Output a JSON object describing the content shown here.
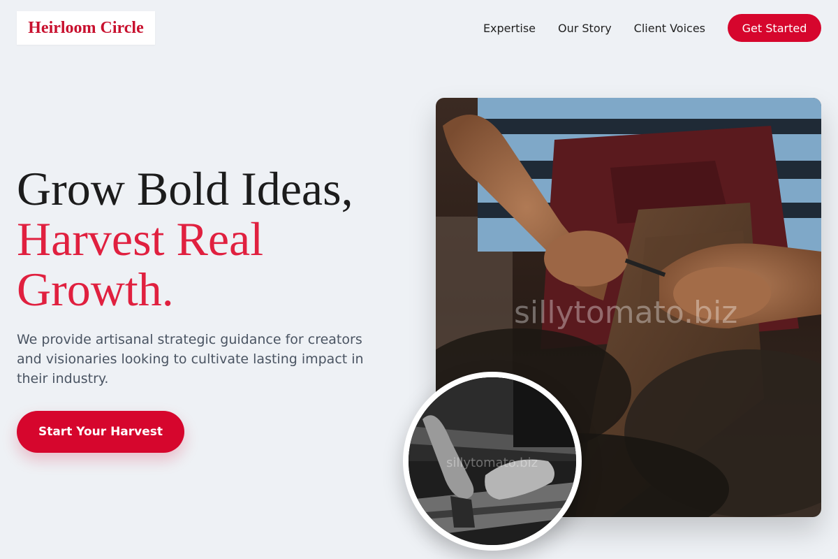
{
  "brand": {
    "name": "Heirloom Circle"
  },
  "nav": {
    "links": [
      "Expertise",
      "Our Story",
      "Client Voices"
    ],
    "cta_label": "Get Started"
  },
  "hero": {
    "headline_line1": "Grow Bold Ideas,",
    "headline_line2": "Harvest Real Growth.",
    "subtext": "We provide artisanal strategic guidance for creators and visionaries looking to cultivate lasting impact in their industry.",
    "cta_label": "Start Your Harvest"
  },
  "images": {
    "watermark_main": "sillytomato.biz",
    "watermark_inset": "sillytomato.biz"
  },
  "colors": {
    "accent": "#d6062d",
    "accent_text": "#e0203f",
    "background": "#eef1f5"
  }
}
